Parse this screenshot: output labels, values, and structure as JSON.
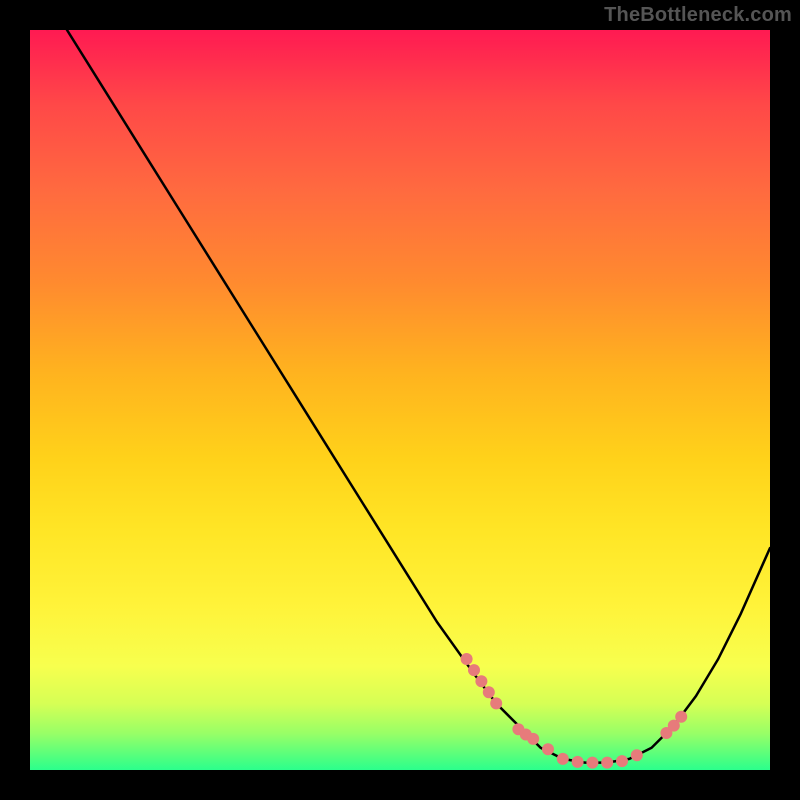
{
  "watermark": "TheBottleneck.com",
  "colors": {
    "curve_stroke": "#000000",
    "marker_fill": "#e77b7b",
    "marker_stroke": "#e77b7b",
    "background_black": "#000000"
  },
  "chart_data": {
    "type": "line",
    "title": "",
    "xlabel": "",
    "ylabel": "",
    "xlim": [
      0,
      100
    ],
    "ylim": [
      0,
      100
    ],
    "curve": {
      "name": "bottleneck-curve",
      "x": [
        5,
        10,
        15,
        20,
        25,
        30,
        35,
        40,
        45,
        50,
        55,
        60,
        63,
        66,
        69,
        72,
        75,
        78,
        81,
        84,
        87,
        90,
        93,
        96,
        100
      ],
      "y": [
        100,
        92,
        84,
        76,
        68,
        60,
        52,
        44,
        36,
        28,
        20,
        13,
        9,
        6,
        3,
        1.5,
        1,
        1,
        1.5,
        3,
        6,
        10,
        15,
        21,
        30
      ]
    },
    "markers": {
      "name": "highlighted-points",
      "x": [
        59,
        60,
        61,
        62,
        63,
        66,
        67,
        68,
        70,
        72,
        74,
        76,
        78,
        80,
        82,
        86,
        87,
        88
      ],
      "y": [
        15,
        13.5,
        12,
        10.5,
        9,
        5.5,
        4.8,
        4.2,
        2.8,
        1.5,
        1.1,
        1,
        1,
        1.2,
        2,
        5,
        6,
        7.2
      ]
    }
  }
}
